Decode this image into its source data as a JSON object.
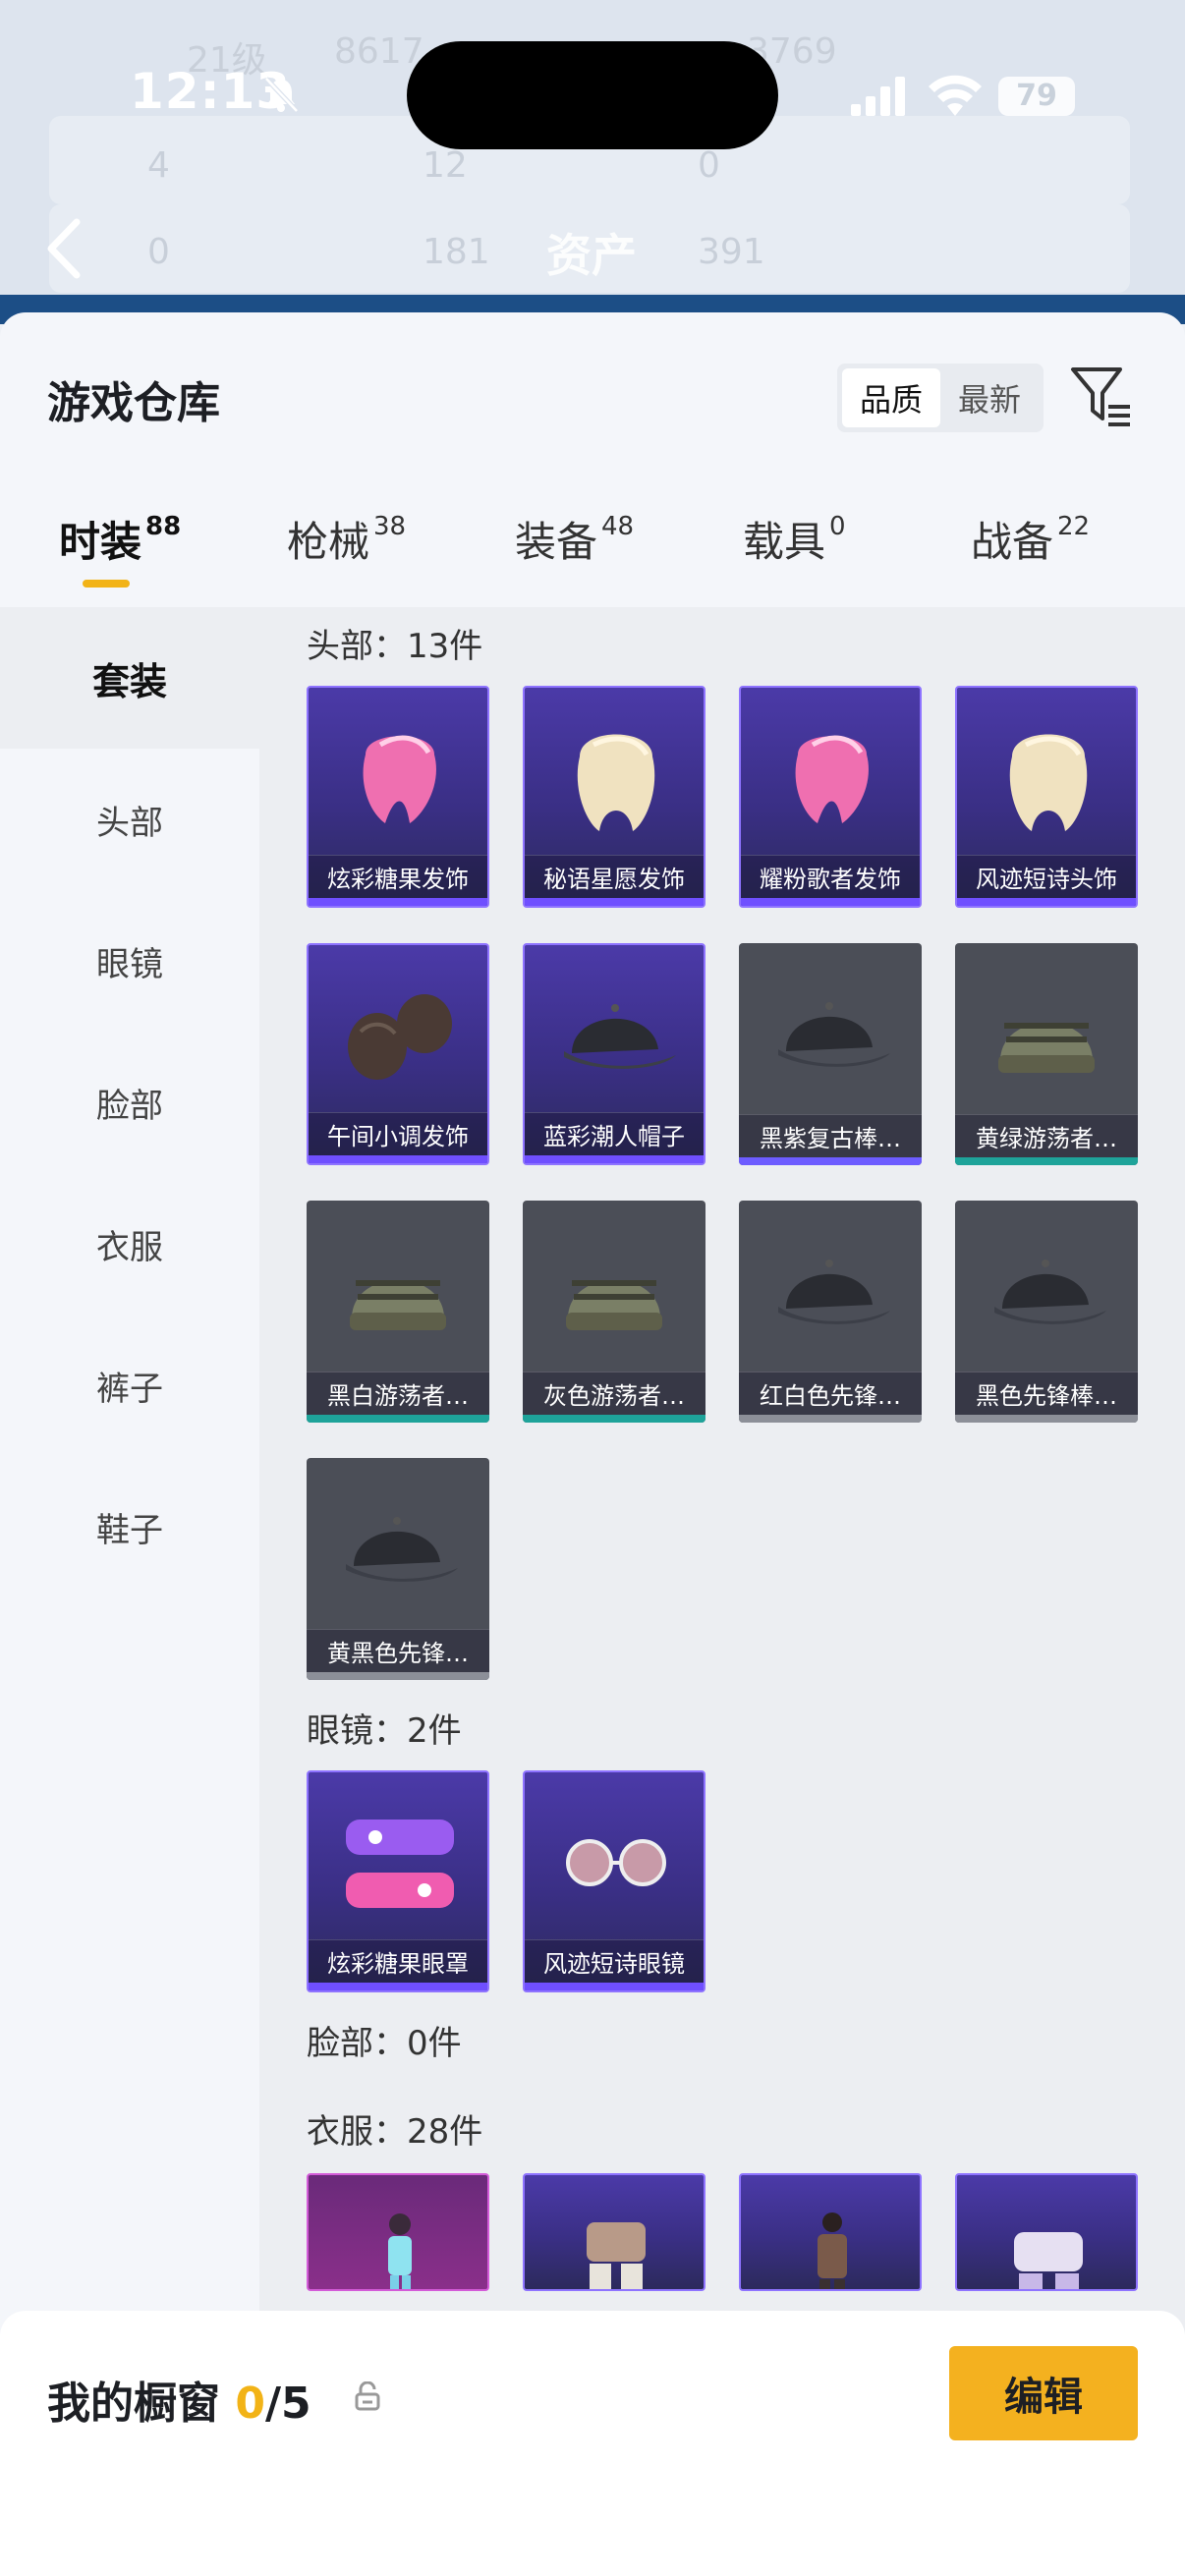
{
  "status_bar": {
    "time": "12:13",
    "battery": "79"
  },
  "header": {
    "title": "资产"
  },
  "background_ghost": {
    "level": "21级",
    "score1": "8617",
    "score2": "3769",
    "row1": [
      "4",
      "12",
      "0"
    ],
    "row2": [
      "0",
      "181",
      "391"
    ]
  },
  "sheet": {
    "title": "游戏仓库"
  },
  "sort": {
    "options": [
      "品质",
      "最新"
    ],
    "active": "品质"
  },
  "tabs": [
    {
      "label": "时装",
      "count": "88"
    },
    {
      "label": "枪械",
      "count": "38"
    },
    {
      "label": "装备",
      "count": "48"
    },
    {
      "label": "载具",
      "count": "0"
    },
    {
      "label": "战备",
      "count": "22"
    }
  ],
  "sidebar": [
    "套装",
    "头部",
    "眼镜",
    "脸部",
    "衣服",
    "裤子",
    "鞋子"
  ],
  "sections": {
    "head": {
      "title": "头部：13件"
    },
    "glasses": {
      "title": "眼镜：2件"
    },
    "face": {
      "title": "脸部：0件"
    },
    "clothes": {
      "title": "衣服：28件"
    }
  },
  "head_items": [
    {
      "name": "炫彩糖果发饰",
      "rarity": "purple",
      "icon": "pink-hair-icon"
    },
    {
      "name": "秘语星愿发饰",
      "rarity": "purple",
      "icon": "blonde-hair-icon"
    },
    {
      "name": "耀粉歌者发饰",
      "rarity": "purple",
      "icon": "pink-hair-icon"
    },
    {
      "name": "风迹短诗头饰",
      "rarity": "purple",
      "icon": "blonde-hair-icon"
    },
    {
      "name": "午间小调发饰",
      "rarity": "purple",
      "icon": "dark-hair-icon"
    },
    {
      "name": "蓝彩潮人帽子",
      "rarity": "purple",
      "icon": "cap-icon"
    },
    {
      "name": "黑紫复古棒…",
      "rarity": "grey",
      "bar": "#6d5cff",
      "icon": "cap-icon"
    },
    {
      "name": "黄绿游荡者…",
      "rarity": "grey",
      "bar": "#1ea39a",
      "icon": "beanie-icon"
    },
    {
      "name": "黑白游荡者…",
      "rarity": "grey",
      "bar": "#1ea39a",
      "icon": "beanie-icon"
    },
    {
      "name": "灰色游荡者…",
      "rarity": "grey",
      "bar": "#1ea39a",
      "icon": "beanie-icon"
    },
    {
      "name": "红白色先锋…",
      "rarity": "grey",
      "bar": "#8c8f98",
      "icon": "cap-icon"
    },
    {
      "name": "黑色先锋棒…",
      "rarity": "grey",
      "bar": "#8c8f98",
      "icon": "cap-icon"
    },
    {
      "name": "黄黑色先锋…",
      "rarity": "grey",
      "bar": "#8c8f98",
      "icon": "cap-icon"
    }
  ],
  "glasses_items": [
    {
      "name": "炫彩糖果眼罩",
      "rarity": "purple",
      "icon": "eye-mask-icon"
    },
    {
      "name": "风迹短诗眼镜",
      "rarity": "purple",
      "icon": "glasses-icon"
    }
  ],
  "bottom": {
    "showcase_label": "我的橱窗",
    "showcase_used": "0",
    "showcase_total": "/5",
    "edit_label": "编辑"
  },
  "colors": {
    "accent": "#f4b11f",
    "purple": "#8e73ff",
    "grey_card": "#4b4e57"
  }
}
